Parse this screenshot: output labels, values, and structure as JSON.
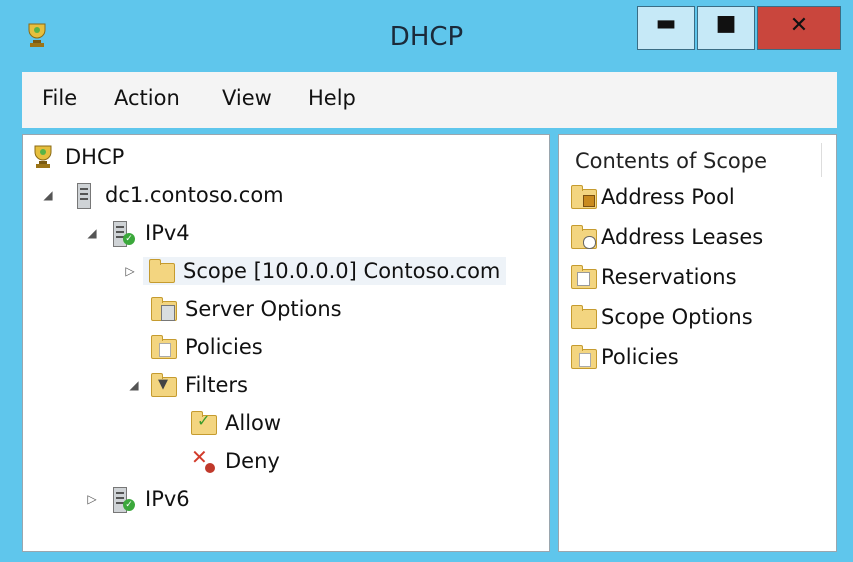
{
  "window": {
    "title": "DHCP"
  },
  "menubar": {
    "items": [
      "File",
      "Action",
      "View",
      "Help"
    ]
  },
  "tree": {
    "root": "DHCP",
    "server": "dc1.contoso.com",
    "ipv4": "IPv4",
    "scope": "Scope [10.0.0.0] Contoso.com",
    "server_options": "Server Options",
    "policies": "Policies",
    "filters": "Filters",
    "allow": "Allow",
    "deny": "Deny",
    "ipv6": "IPv6"
  },
  "content": {
    "header": "Contents of Scope",
    "items": [
      "Address Pool",
      "Address Leases",
      "Reservations",
      "Scope Options",
      "Policies"
    ]
  },
  "icons": {
    "app": "dhcp-trophy-icon",
    "server": "server-icon",
    "folder": "folder-icon",
    "filter": "filter-icon",
    "allow": "allow-check-icon",
    "deny": "deny-x-icon"
  },
  "colors": {
    "titlebar": "#5fc6ec",
    "close_button": "#c9463d",
    "folder": "#f3d580"
  }
}
